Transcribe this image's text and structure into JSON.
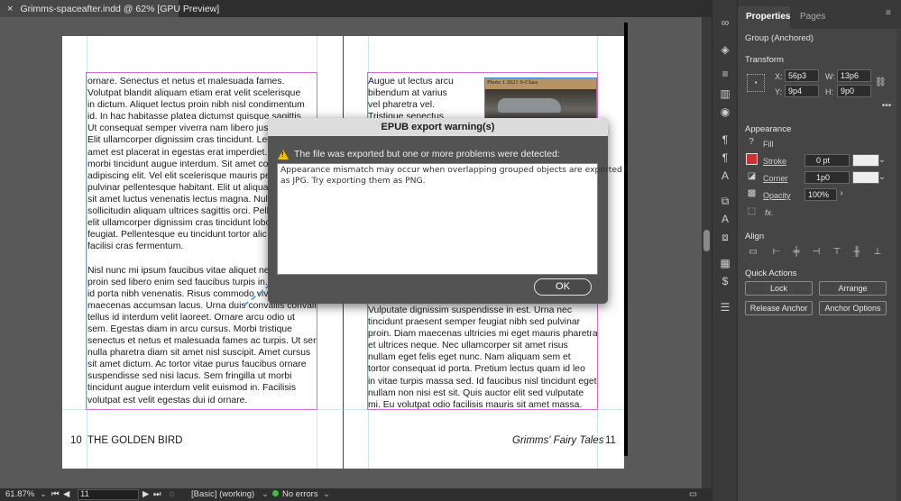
{
  "document_tab": {
    "close": "×",
    "title": "Grimms-spaceafter.indd @ 62% [GPU Preview]"
  },
  "left_page": {
    "column_text": "ornare. Senectus et netus et malesuada fames.\nVolutpat blandit aliquam etiam erat velit scelerisque\nin dictum. Aliquet lectus proin nibh nisl condimentum\nid. In hac habitasse platea dictumst quisque sagittis.\nUt consequat semper viverra nam libero justo\nElit ullamcorper dignissim cras tincidunt. Lectus\namet est placerat in egestas erat imperdiet.\nmorbi tincidunt augue interdum. Sit amet co\nadipiscing elit. Vel elit scelerisque mauris pe\npulvinar pellentesque habitant. Elit ut aliquam\nsit amet luctus venenatis lectus magna. Null\nsollicitudin aliquam ultrices sagittis orci. Pell\nelit ullamcorper dignissim cras tincidunt lobo\nfeugiat. Pellentesque eu tincidunt tortor alic\nfacilisi cras fermentum.\n\nNisl nunc mi ipsum faucibus vitae aliquet ne\nproin sed libero enim sed faucibus turpis in.\nid porta nibh venenatis. Risus commodo viv\nmaecenas accumsan lacus. Urna duis convallis convallis\ntellus id interdum velit laoreet. Ornare arcu odio ut\nsem. Egestas diam in arcu cursus. Morbi tristique\nsenectus et netus et malesuada fames ac turpis. Ut sem\nnulla pharetra diam sit amet nisl suscipit. Amet cursus\nsit amet dictum. Ac tortor vitae purus faucibus ornare\nsuspendisse sed nisi lacus. Sem fringilla ut morbi\ntincidunt augue interdum velit euismod in. Facilisis\nvolutpat est velit egestas dui id ornare.",
    "page_number": "10",
    "running_head": "THE GOLDEN BIRD"
  },
  "right_page": {
    "column_text_top": "Augue ut lectus arcu\nbibendum at varius\nvel pharetra vel.\nTristique senectus",
    "column_text_bottom": "Vulputate dignissim suspendisse in est. Urna nec\ntincidunt praesent semper feugiat nibh sed pulvinar\nproin. Diam maecenas ultricies mi eget mauris pharetra\net ultrices neque. Nec ullamcorper sit amet risus\nnullam eget felis eget nunc. Nam aliquam sem et\ntortor consequat id porta. Pretium lectus quam id leo\nin vitae turpis massa sed. Id faucibus nisl tincidunt eget\nnullam non nisi est sit. Quis auctor elit sed vulputate\nmi. Eu volutpat odio facilisis mauris sit amet massa.",
    "photo_caption": "Photo 1 2021 S-Class",
    "running_head": "Grimms' Fairy Tales",
    "page_number": "11"
  },
  "dialog": {
    "title": "EPUB export warning(s)",
    "warning_icon": "warning-icon",
    "heading": "The file was exported but one or more problems were detected:",
    "message": "Appearance mismatch may occur when overlapping grouped objects are exported\nas JPG. Try exporting them as PNG.",
    "ok_label": "OK"
  },
  "status_bar": {
    "zoom": "61.87%",
    "page": "11",
    "style": "[Basic] (working)",
    "errors": "No errors"
  },
  "panel": {
    "tabs": [
      "Properties",
      "Pages"
    ],
    "selection": "Group (Anchored)",
    "transform": {
      "title": "Transform",
      "x_label": "X:",
      "x": "56p3",
      "y_label": "Y:",
      "y": "9p4",
      "w_label": "W:",
      "w": "13p6",
      "h_label": "H:",
      "h": "9p0"
    },
    "appearance": {
      "title": "Appearance",
      "fill": "Fill",
      "stroke": "Stroke",
      "stroke_value": "0 pt",
      "corner": "Corner",
      "corner_value": "1p0",
      "opacity": "Opacity",
      "opacity_value": "100%",
      "fx": "fx."
    },
    "align": {
      "title": "Align"
    },
    "quick_actions": {
      "title": "Quick Actions",
      "lock": "Lock",
      "arrange": "Arrange",
      "release_anchor": "Release Anchor",
      "anchor_options": "Anchor Options"
    }
  }
}
